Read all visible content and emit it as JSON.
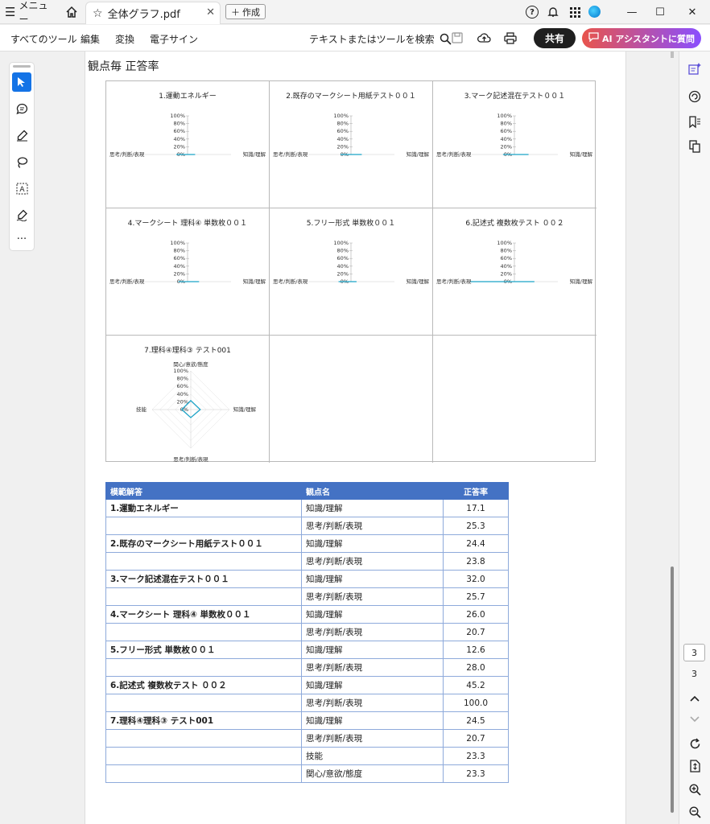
{
  "titlebar": {
    "menu_label": "メニュー",
    "tab_title": "全体グラフ.pdf",
    "new_tab_label": "作成"
  },
  "toolbar": {
    "menus": [
      "すべてのツール",
      "編集",
      "変換",
      "電子サイン"
    ],
    "search_label": "テキストまたはツールを検索",
    "share_label": "共有",
    "ai_label": "AI アシスタントに質問"
  },
  "left_tools": [
    "select-pointer-icon",
    "comment-icon",
    "highlight-pen-icon",
    "draw-lasso-icon",
    "text-box-icon",
    "sign-pen-icon",
    "more-icon"
  ],
  "document": {
    "heading": "観点毎 正答率",
    "percent_ticks": [
      "100%",
      "80%",
      "60%",
      "40%",
      "20%",
      "0%"
    ],
    "charts": [
      {
        "title": "1.運動エネルギー",
        "left_label": "思考/判断/表現",
        "right_label": "知識/理解",
        "type": "radar2"
      },
      {
        "title": "2.既存のマークシート用紙テスト００１",
        "left_label": "思考/判断/表現",
        "right_label": "知識/理解",
        "type": "radar2"
      },
      {
        "title": "3.マーク記述混在テスト００１",
        "left_label": "思考/判断/表現",
        "right_label": "知識/理解",
        "type": "radar2"
      },
      {
        "title": "4.マークシート 理科④ 単数枚００１",
        "left_label": "思考/判断/表現",
        "right_label": "知識/理解",
        "type": "radar2"
      },
      {
        "title": "5.フリー形式 単数枚００１",
        "left_label": "思考/判断/表現",
        "right_label": "知識/理解",
        "type": "radar2"
      },
      {
        "title": "6.記述式 複数枚テスト ００２",
        "left_label": "思考/判断/表現",
        "right_label": "知識/理解",
        "type": "radar2"
      },
      {
        "title": "7.理科④理科③ テスト001",
        "top_label": "関心/意欲/態度",
        "right_label": "知識/理解",
        "bottom_label": "思考/判断/表現",
        "left_label": "技能",
        "type": "radar4"
      }
    ]
  },
  "chart_data": [
    {
      "type": "radar",
      "title": "1.運動エネルギー",
      "axes": [
        "知識/理解",
        "思考/判断/表現"
      ],
      "values": [
        17.1,
        25.3
      ],
      "ylim": [
        0,
        100
      ]
    },
    {
      "type": "radar",
      "title": "2.既存のマークシート用紙テスト００１",
      "axes": [
        "知識/理解",
        "思考/判断/表現"
      ],
      "values": [
        24.4,
        23.8
      ],
      "ylim": [
        0,
        100
      ]
    },
    {
      "type": "radar",
      "title": "3.マーク記述混在テスト００１",
      "axes": [
        "知識/理解",
        "思考/判断/表現"
      ],
      "values": [
        32.0,
        25.7
      ],
      "ylim": [
        0,
        100
      ]
    },
    {
      "type": "radar",
      "title": "4.マークシート 理科④ 単数枚００１",
      "axes": [
        "知識/理解",
        "思考/判断/表現"
      ],
      "values": [
        26.0,
        20.7
      ],
      "ylim": [
        0,
        100
      ]
    },
    {
      "type": "radar",
      "title": "5.フリー形式 単数枚００１",
      "axes": [
        "知識/理解",
        "思考/判断/表現"
      ],
      "values": [
        12.6,
        28.0
      ],
      "ylim": [
        0,
        100
      ]
    },
    {
      "type": "radar",
      "title": "6.記述式 複数枚テスト ００２",
      "axes": [
        "知識/理解",
        "思考/判断/表現"
      ],
      "values": [
        45.2,
        100.0
      ],
      "ylim": [
        0,
        100
      ]
    },
    {
      "type": "radar",
      "title": "7.理科④理科③ テスト001",
      "axes": [
        "関心/意欲/態度",
        "知識/理解",
        "思考/判断/表現",
        "技能"
      ],
      "values": [
        23.3,
        24.5,
        20.7,
        23.3
      ],
      "ylim": [
        0,
        100
      ]
    }
  ],
  "table": {
    "headers": [
      "模範解答",
      "観点名",
      "正答率"
    ],
    "rows": [
      {
        "q": "1.運動エネルギー",
        "kanten": "知識/理解",
        "rate": "17.1"
      },
      {
        "q": "",
        "kanten": "思考/判断/表現",
        "rate": "25.3"
      },
      {
        "q": "2.既存のマークシート用紙テスト００１",
        "kanten": "知識/理解",
        "rate": "24.4"
      },
      {
        "q": "",
        "kanten": "思考/判断/表現",
        "rate": "23.8"
      },
      {
        "q": "3.マーク記述混在テスト００１",
        "kanten": "知識/理解",
        "rate": "32.0"
      },
      {
        "q": "",
        "kanten": "思考/判断/表現",
        "rate": "25.7"
      },
      {
        "q": "4.マークシート 理科④ 単数枚００１",
        "kanten": "知識/理解",
        "rate": "26.0"
      },
      {
        "q": "",
        "kanten": "思考/判断/表現",
        "rate": "20.7"
      },
      {
        "q": "5.フリー形式 単数枚００１",
        "kanten": "知識/理解",
        "rate": "12.6"
      },
      {
        "q": "",
        "kanten": "思考/判断/表現",
        "rate": "28.0"
      },
      {
        "q": "6.記述式 複数枚テスト ００２",
        "kanten": "知識/理解",
        "rate": "45.2"
      },
      {
        "q": "",
        "kanten": "思考/判断/表現",
        "rate": "100.0"
      },
      {
        "q": "7.理科④理科③ テスト001",
        "kanten": "知識/理解",
        "rate": "24.5"
      },
      {
        "q": "",
        "kanten": "思考/判断/表現",
        "rate": "20.7"
      },
      {
        "q": "",
        "kanten": "技能",
        "rate": "23.3"
      },
      {
        "q": "",
        "kanten": "関心/意欲/態度",
        "rate": "23.3"
      }
    ]
  },
  "page_nav": {
    "current_page": "3",
    "total_pages": "3"
  },
  "colors": {
    "accent": "#1473e6",
    "table_header": "#4472c4",
    "table_border": "#8eaadb",
    "chart_line": "#1aa3c8"
  }
}
